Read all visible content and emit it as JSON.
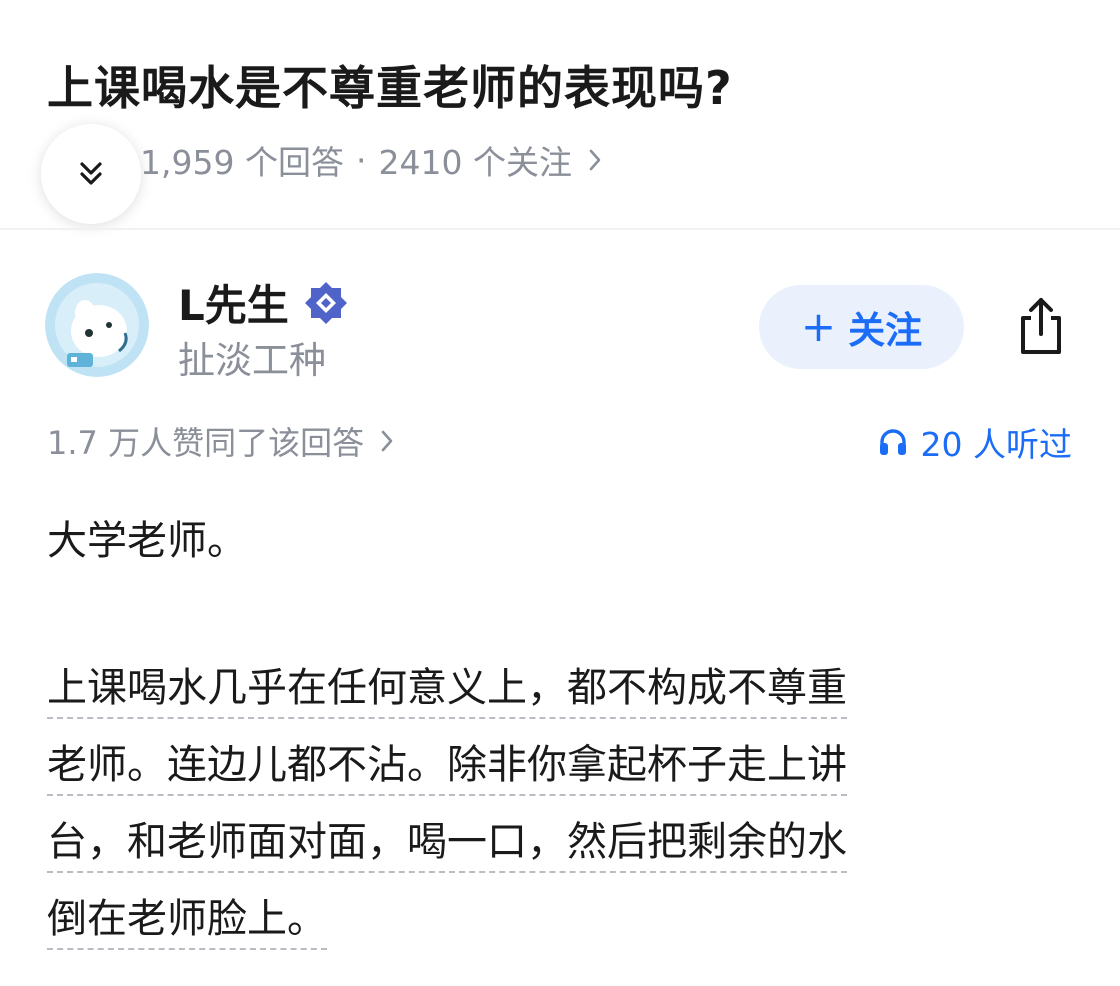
{
  "question": {
    "title": "上课喝水是不尊重老师的表现吗?",
    "answer_count": "1,959 个回答",
    "separator": "·",
    "follower_count": "2410 个关注"
  },
  "author": {
    "name": "L先生",
    "bio": "扯淡工种",
    "follow_label": "关注"
  },
  "stats": {
    "votes": "1.7 万人赞同了该回答",
    "listens": "20 人听过"
  },
  "answer": {
    "lead": "大学老师。",
    "lines": [
      "上课喝水几乎在任何意义上，都不构成不尊重",
      "老师。连边儿都不沾。除非你拿起杯子走上讲",
      "台，和老师面对面，喝一口，然后把剩余的水",
      "倒在老师脸上。"
    ]
  },
  "icons": {
    "collapse": "double-chevron-down-icon",
    "verified": "verified-badge-icon",
    "share": "share-icon",
    "headphones": "headphones-icon"
  },
  "colors": {
    "accent": "#1b6df7",
    "follow_bg": "#eaf1fd",
    "muted_text": "#8a8f99",
    "badge": "#4f63c9"
  }
}
